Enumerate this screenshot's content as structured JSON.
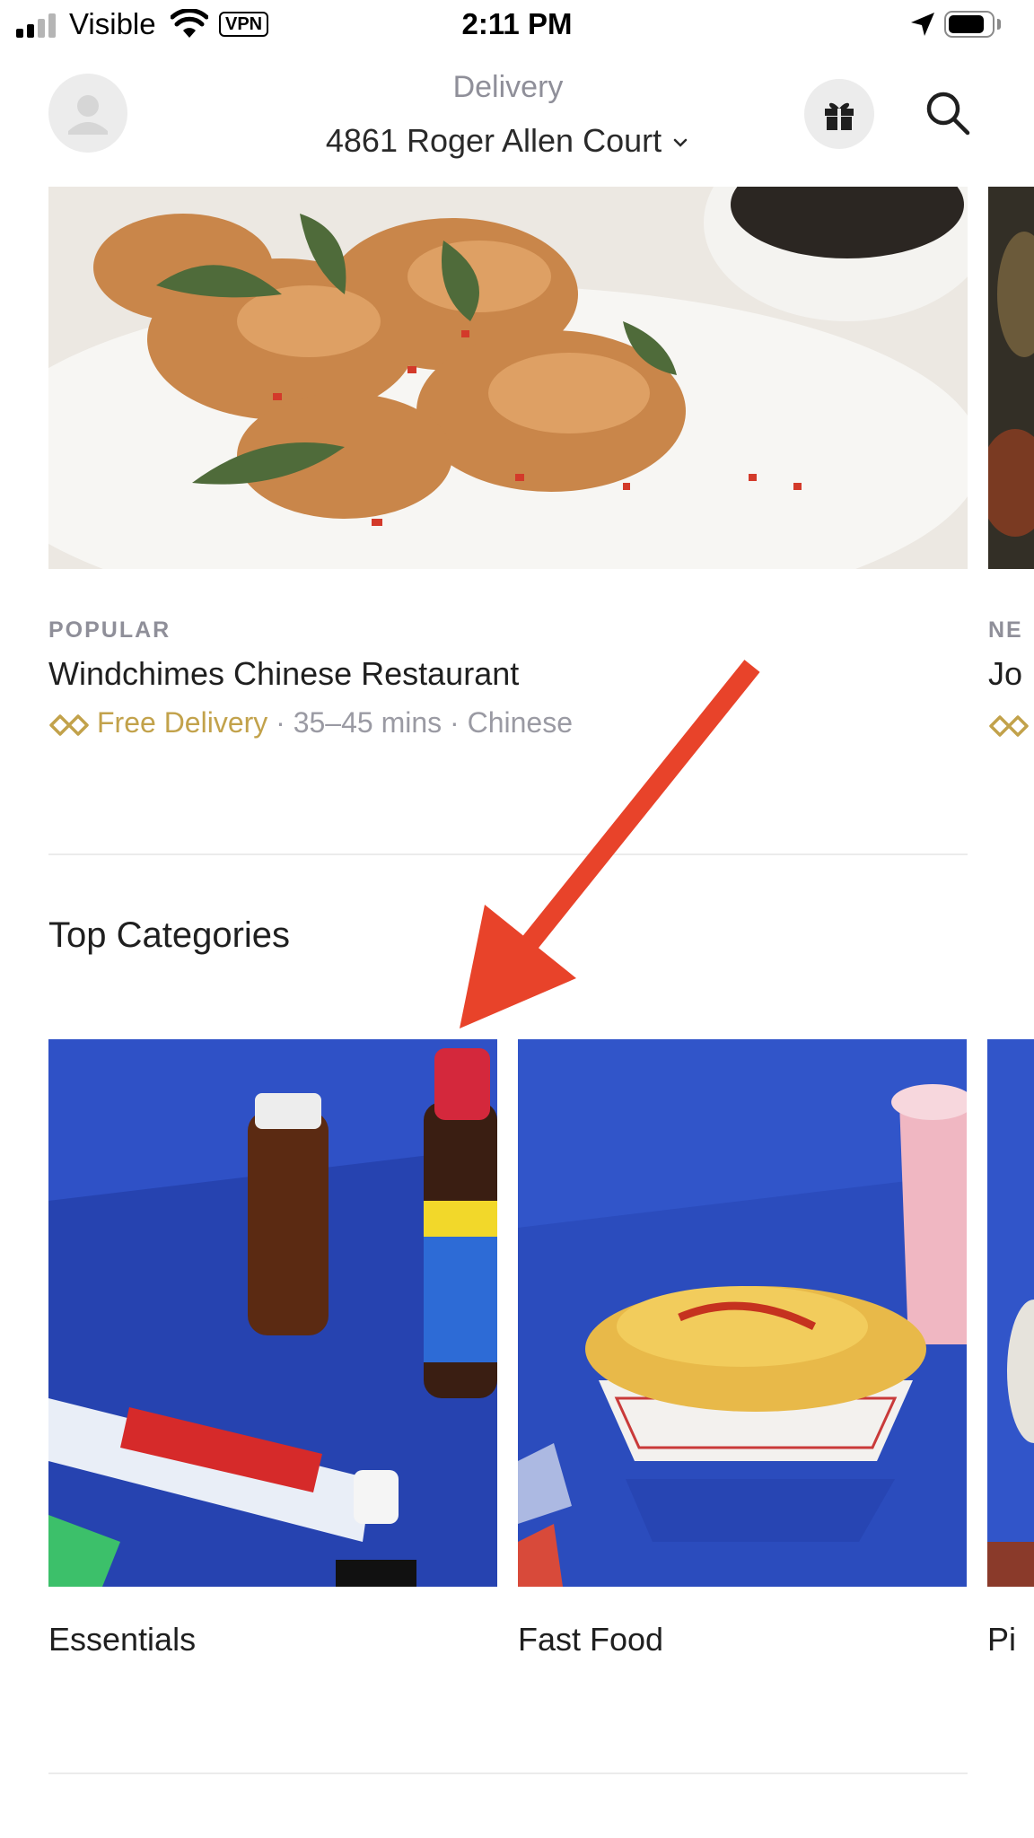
{
  "status_bar": {
    "carrier": "Visible",
    "vpn": "VPN",
    "time": "2:11 PM"
  },
  "header": {
    "mode_label": "Delivery",
    "address": "4861 Roger Allen Court",
    "avatar_icon": "avatar-icon",
    "gift_icon": "gift-icon",
    "search_icon": "search-icon",
    "address_chevron_icon": "chevron-down-icon"
  },
  "featured": {
    "tag": "POPULAR",
    "name": "Windchimes Chinese Restaurant",
    "delivery_offer": "Free Delivery",
    "time_range": "35–45 mins",
    "cuisine": "Chinese",
    "separator": "·",
    "offer_icon": "dashpass-icon",
    "offer_color": "#c2a24b"
  },
  "featured_peek": {
    "tag": "NE",
    "name": "Jo"
  },
  "categories": {
    "title": "Top Categories",
    "items": [
      {
        "label": "Essentials",
        "background": "#2f51c6"
      },
      {
        "label": "Fast Food",
        "background": "#3155c9"
      },
      {
        "label": "Pi",
        "background": "#3155c9"
      }
    ]
  },
  "annotation": {
    "type": "red-arrow",
    "color": "#e8432a"
  }
}
